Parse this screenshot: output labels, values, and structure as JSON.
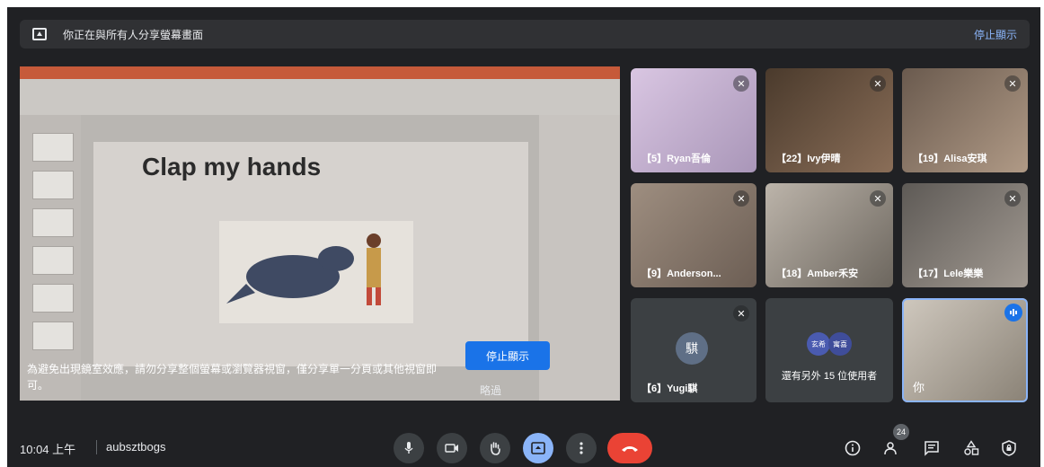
{
  "banner": {
    "text": "你正在與所有人分享螢幕畫面",
    "stop_label": "停止顯示"
  },
  "presentation": {
    "slide_title": "Clap my hands",
    "overlay_message": "為避免出現鏡室效應，請勿分享整個螢幕或瀏覽器視窗，僅分享單一分頁或其他視窗即可。",
    "stop_button_label": "停止顯示",
    "dismiss_label": "略過"
  },
  "participants": [
    {
      "name": "【5】Ryan吾倫",
      "muted": true,
      "bg": "#c9b8d6"
    },
    {
      "name": "【22】Ivy伊晴",
      "muted": true,
      "bg": "#5a4636"
    },
    {
      "name": "【19】Alisa安琪",
      "muted": true,
      "bg": "#7c6a5c"
    },
    {
      "name": "【9】Anderson...",
      "muted": true,
      "bg": "#8a7a6e"
    },
    {
      "name": "【18】Amber禾安",
      "muted": true,
      "bg": "#9c948a"
    },
    {
      "name": "【17】Lele樂樂",
      "muted": true,
      "bg": "#6f6a66"
    }
  ],
  "yugi": {
    "name": "【6】Yugi騏",
    "initial": "騏",
    "muted": true
  },
  "others": {
    "avatars": [
      "玄希",
      "寓喜"
    ],
    "text": "還有另外 15 位使用者"
  },
  "self": {
    "name": "你"
  },
  "bottom_bar": {
    "time": "10:04 上午",
    "meeting_code": "aubsztbogs",
    "people_count": "24"
  }
}
